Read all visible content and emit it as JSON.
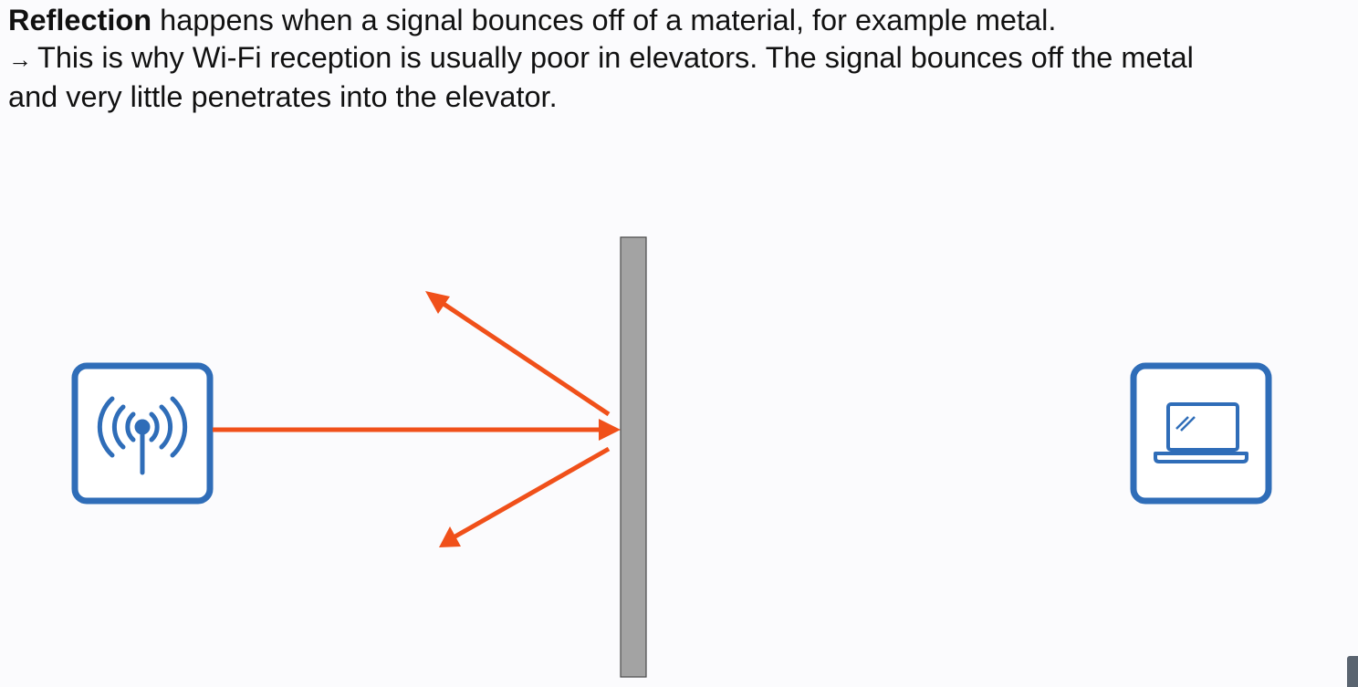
{
  "slide": {
    "heading_bold": "Reflection",
    "heading_rest": " happens when a signal bounces off of a material, for example metal.",
    "note_arrow": "→",
    "note_line1": "This is why Wi-Fi reception is usually poor in elevators.  The signal bounces off the metal",
    "note_line2": "and very little penetrates into the elevator."
  },
  "diagram": {
    "source_icon": "wireless-access-point-icon",
    "target_icon": "laptop-icon",
    "barrier": "metal-wall",
    "colors": {
      "icon_blue": "#2f6db8",
      "signal_orange": "#f0501a",
      "wall_gray": "#a3a3a3",
      "wall_border": "#4a4a4a"
    }
  }
}
